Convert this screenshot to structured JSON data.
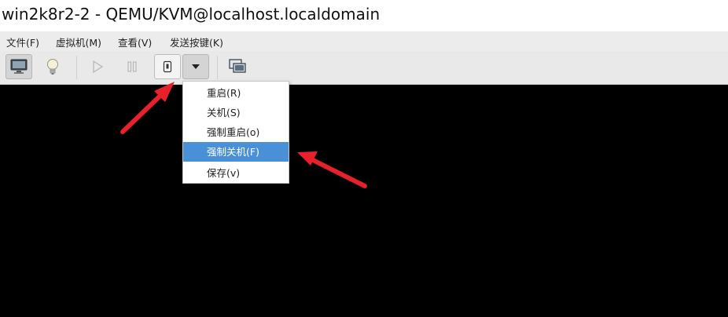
{
  "window": {
    "title": "win2k8r2-2 - QEMU/KVM@localhost.localdomain"
  },
  "menubar": {
    "items": [
      {
        "label": "文件(F)"
      },
      {
        "label": "虚拟机(M)"
      },
      {
        "label": "查看(V)"
      },
      {
        "label": "发送按键(K)"
      }
    ]
  },
  "toolbar": {
    "buttons": [
      {
        "icon": "monitor-icon",
        "state": "pressed"
      },
      {
        "icon": "lightbulb-icon",
        "state": "normal"
      },
      {
        "icon": "play-icon",
        "state": "disabled"
      },
      {
        "icon": "pause-icon",
        "state": "disabled"
      },
      {
        "icon": "power-icon",
        "state": "normal"
      },
      {
        "icon": "chevron-down-icon",
        "state": "open"
      },
      {
        "icon": "screenshot-icon",
        "state": "normal"
      }
    ]
  },
  "shutdown_menu": {
    "items": [
      {
        "label": "重启(R)"
      },
      {
        "label": "关机(S)"
      },
      {
        "label": "强制重启(o)"
      },
      {
        "label": "强制关机(F)",
        "highlighted": true
      },
      {
        "label": "保存(v)"
      }
    ]
  },
  "colors": {
    "highlight": "#4a90d9",
    "annotation_arrow": "#e8202a",
    "console_background": "#000000"
  }
}
